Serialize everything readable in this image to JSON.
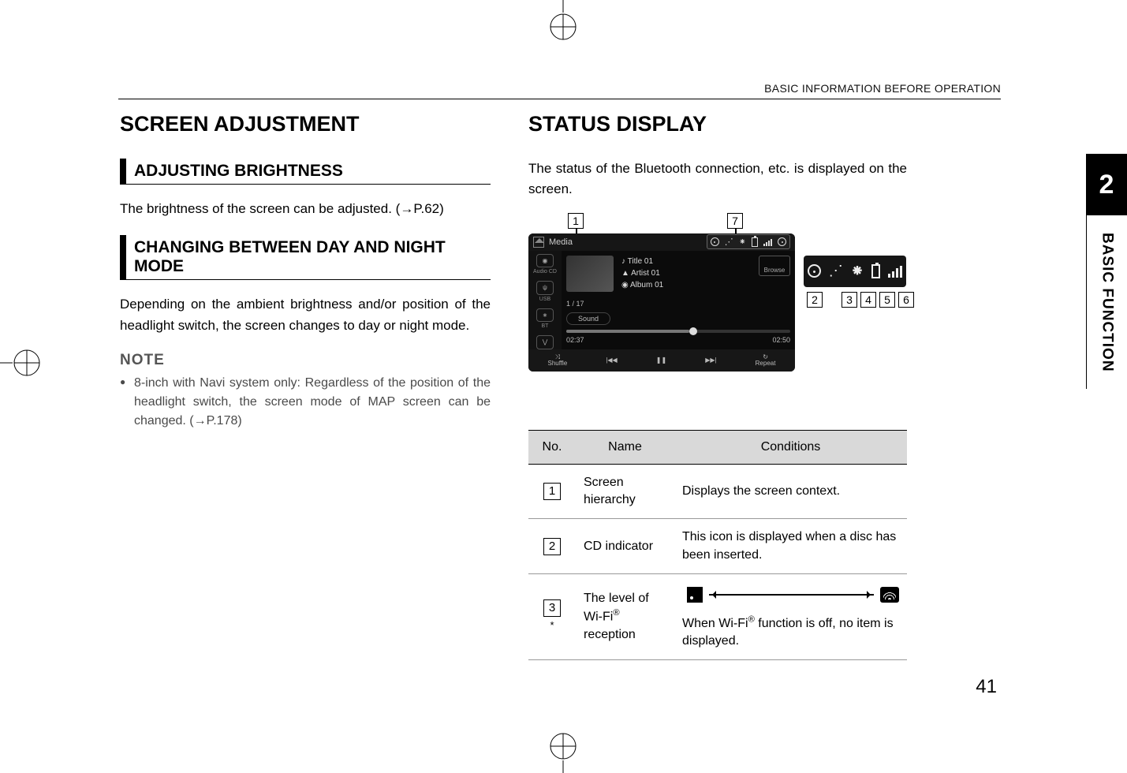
{
  "running_head": "BASIC INFORMATION BEFORE OPERATION",
  "page_number": "41",
  "chapter_tab": "2",
  "section_tab": "BASIC FUNCTION",
  "left": {
    "h1": "SCREEN ADJUSTMENT",
    "sub1": "ADJUSTING BRIGHTNESS",
    "body1": "The brightness of the screen can be adjusted. (→P.62)",
    "sub2": "CHANGING BETWEEN DAY AND NIGHT MODE",
    "body2": "Depending on the ambient brightness and/or position of the headlight switch, the screen changes to day or night mode.",
    "note_head": "NOTE",
    "note1": "8-inch with Navi system only: Regardless of the position of the headlight switch, the screen mode of MAP screen can be changed. (→P.178)"
  },
  "right": {
    "h1": "STATUS DISPLAY",
    "intro": "The status of the Bluetooth connection, etc. is displayed on the screen.",
    "screenshot": {
      "breadcrumb": "Media",
      "sidebar": {
        "item1": "Audio CD",
        "item2": "USB",
        "item3": "BT"
      },
      "title": "Title 01",
      "artist": "Artist 01",
      "album": "Album 01",
      "browse": "Browse",
      "track": "1 / 17",
      "sound": "Sound",
      "time_elapsed": "02:37",
      "time_total": "02:50",
      "footer": {
        "shuffle": "Shuffle",
        "prev": "|◀◀",
        "pause": "❚❚",
        "next": "▶▶|",
        "repeat": "Repeat"
      }
    },
    "callouts": {
      "c1": "1",
      "c2": "2",
      "c3": "3",
      "c4": "4",
      "c5": "5",
      "c6": "6",
      "c7": "7"
    },
    "table": {
      "head_no": "No.",
      "head_name": "Name",
      "head_cond": "Conditions",
      "rows": [
        {
          "no": "1",
          "name": "Screen hierarchy",
          "cond": "Displays the screen context."
        },
        {
          "no": "2",
          "name": "CD indicator",
          "cond": "This icon is displayed when a disc has been inserted."
        },
        {
          "no": "3",
          "no_suffix": "*",
          "name": "The level of Wi-Fi® reception",
          "cond_tail": "When Wi-Fi® function is off, no item is displayed."
        }
      ]
    }
  }
}
